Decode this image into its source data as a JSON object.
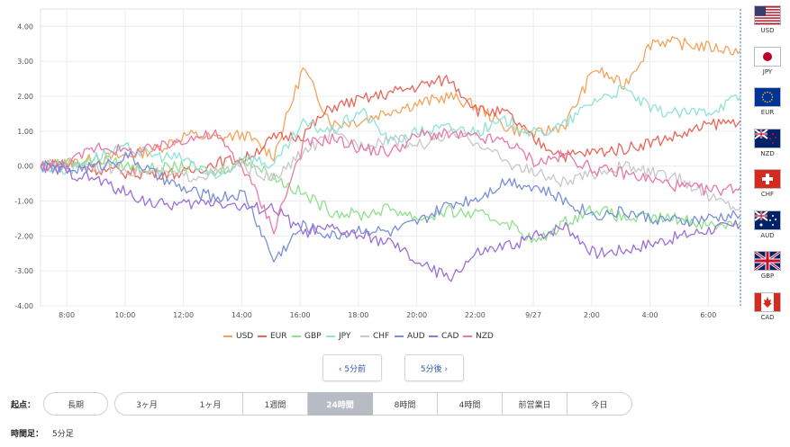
{
  "chart_data": {
    "type": "line",
    "ylim": [
      -4,
      4.5
    ],
    "y_ticks": [
      "4.00",
      "3.00",
      "2.00",
      "1.00",
      "0.00",
      "-1.00",
      "-2.00",
      "-3.00",
      "-4.00"
    ],
    "y_tick_values": [
      4,
      3,
      2,
      1,
      0,
      -1,
      -2,
      -3,
      -4
    ],
    "x_ticks": [
      "8:00",
      "10:00",
      "12:00",
      "14:00",
      "16:00",
      "18:00",
      "20:00",
      "22:00",
      "9/27",
      "2:00",
      "4:00",
      "6:00"
    ],
    "grid": true,
    "legend_placement": "bottom",
    "x_points_hours": [
      0,
      1,
      2,
      3,
      4,
      5,
      6,
      7,
      8,
      9,
      10,
      11,
      12,
      13,
      14,
      15,
      16,
      17,
      18,
      19,
      20,
      21,
      22,
      23,
      24
    ],
    "series": [
      {
        "name": "USD",
        "color": "#f2a45c",
        "values": [
          0,
          0.1,
          0.2,
          0.3,
          0.5,
          0.9,
          0.8,
          0.9,
          0.3,
          2.8,
          1.2,
          1.3,
          1.6,
          1.8,
          2.0,
          1.7,
          1.1,
          0.9,
          1.2,
          2.8,
          2.3,
          3.6,
          3.5,
          3.4,
          3.3
        ]
      },
      {
        "name": "EUR",
        "color": "#e8675a",
        "values": [
          0,
          0.1,
          -0.1,
          -0.2,
          -0.2,
          -0.2,
          0.1,
          0.2,
          0.8,
          0.9,
          1.7,
          1.9,
          2.1,
          2.3,
          2.5,
          1.6,
          1.5,
          0.7,
          0.3,
          0.4,
          0.5,
          0.7,
          0.9,
          1.2,
          1.3
        ]
      },
      {
        "name": "GBP",
        "color": "#8ee08c",
        "values": [
          0,
          0.1,
          0.2,
          0.0,
          -0.1,
          0.0,
          -0.2,
          0.2,
          -0.3,
          -0.8,
          -1.3,
          -1.4,
          -1.2,
          -1.5,
          -1.3,
          -1.4,
          -1.6,
          -2.2,
          -1.6,
          -1.2,
          -1.5,
          -1.5,
          -1.5,
          -1.7,
          -1.6
        ]
      },
      {
        "name": "JPY",
        "color": "#8fe3d8",
        "values": [
          0,
          -0.1,
          0.3,
          0.5,
          0.3,
          0.2,
          -0.4,
          0.3,
          0.0,
          1.2,
          1.0,
          1.6,
          0.7,
          1.0,
          1.1,
          1.0,
          1.3,
          0.9,
          1.2,
          1.9,
          2.2,
          1.6,
          1.5,
          1.6,
          2.0
        ]
      },
      {
        "name": "CHF",
        "color": "#c8c8c8",
        "values": [
          0,
          0.1,
          0.0,
          -0.1,
          -0.2,
          -0.3,
          -0.2,
          0.0,
          -0.4,
          0.4,
          0.9,
          0.6,
          0.8,
          0.6,
          0.9,
          0.7,
          0.1,
          -0.2,
          -0.5,
          -0.2,
          0.0,
          -0.2,
          -0.4,
          -0.9,
          -1.2
        ]
      },
      {
        "name": "AUD",
        "color": "#7a90d6",
        "values": [
          0,
          -0.1,
          0.0,
          0.3,
          -0.3,
          -0.7,
          -0.9,
          -0.8,
          -2.7,
          -1.7,
          -2.0,
          -1.8,
          -1.9,
          -1.6,
          -1.1,
          -0.9,
          -0.4,
          -0.6,
          -1.0,
          -1.4,
          -1.3,
          -1.5,
          -1.6,
          -1.5,
          -1.4
        ]
      },
      {
        "name": "CAD",
        "color": "#9c70d8",
        "values": [
          0,
          -0.2,
          -0.4,
          -0.8,
          -1.1,
          -1.1,
          -1.0,
          -1.2,
          -1.2,
          -1.9,
          -1.8,
          -2.0,
          -2.2,
          -2.8,
          -3.2,
          -2.5,
          -2.3,
          -2.0,
          -1.7,
          -2.5,
          -2.4,
          -2.2,
          -2.0,
          -1.8,
          -1.7
        ]
      },
      {
        "name": "NZD",
        "color": "#e87aa8",
        "values": [
          0,
          0.1,
          0.6,
          0.4,
          0.5,
          0.8,
          0.9,
          -0.1,
          -1.8,
          0.6,
          0.8,
          0.5,
          0.4,
          0.9,
          0.9,
          0.8,
          0.7,
          0.1,
          0.3,
          -0.1,
          -0.2,
          -0.4,
          -0.6,
          -0.7,
          -0.6
        ]
      }
    ]
  },
  "flags": [
    {
      "code": "USD",
      "icon": "us-flag-icon"
    },
    {
      "code": "JPY",
      "icon": "jp-flag-icon"
    },
    {
      "code": "EUR",
      "icon": "eu-flag-icon"
    },
    {
      "code": "NZD",
      "icon": "nz-flag-icon"
    },
    {
      "code": "CHF",
      "icon": "ch-flag-icon"
    },
    {
      "code": "AUD",
      "icon": "au-flag-icon"
    },
    {
      "code": "GBP",
      "icon": "gb-flag-icon"
    },
    {
      "code": "CAD",
      "icon": "ca-flag-icon"
    }
  ],
  "nav": {
    "prev_label": "‹ 5分前",
    "next_label": "5分後 ›"
  },
  "start": {
    "label": "起点：",
    "options": [
      "長期",
      "3ヶ月",
      "1ヶ月",
      "1週間",
      "24時間",
      "8時間",
      "4時間",
      "前営業日",
      "今日"
    ],
    "active": "24時間"
  },
  "timeframe": {
    "label": "時間足：",
    "value": "5分足"
  }
}
